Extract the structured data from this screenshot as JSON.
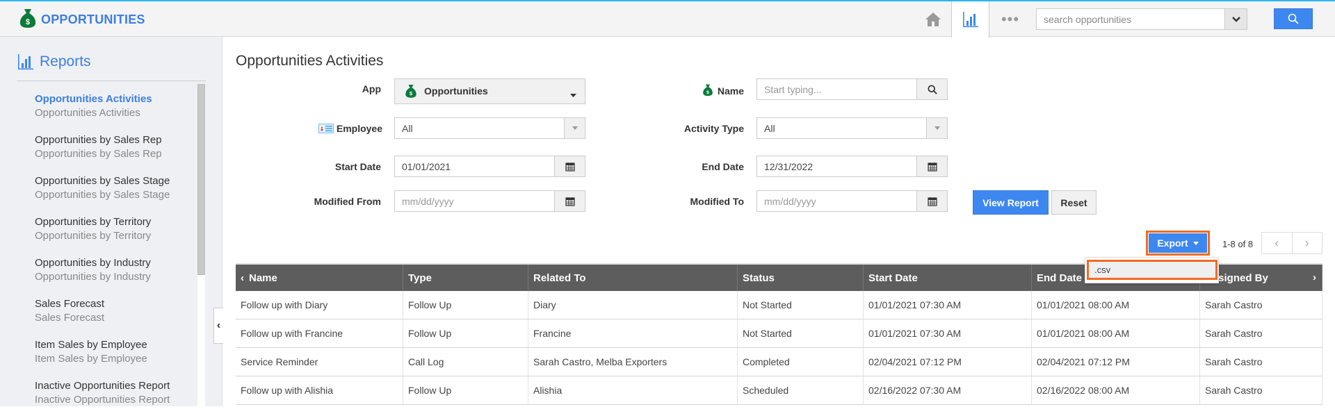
{
  "header": {
    "app_title": "OPPORTUNITIES",
    "icons": [
      "money-bag-icon",
      "home-icon",
      "bar-chart-icon",
      "more-dots-icon"
    ],
    "search": {
      "placeholder": "search opportunities",
      "value": ""
    },
    "search_button_icon": "search-icon",
    "accent_color": "#3d7fe0"
  },
  "sidebar": {
    "title": "Reports",
    "items": [
      {
        "title": "Opportunities Activities",
        "subtitle": "Opportunities Activities",
        "active": true
      },
      {
        "title": "Opportunities by Sales Rep",
        "subtitle": "Opportunities by Sales Rep"
      },
      {
        "title": "Opportunities by Sales Stage",
        "subtitle": "Opportunities by Sales Stage"
      },
      {
        "title": "Opportunities by Territory",
        "subtitle": "Opportunities by Territory"
      },
      {
        "title": "Opportunities by Industry",
        "subtitle": "Opportunities by Industry"
      },
      {
        "title": "Sales Forecast",
        "subtitle": "Sales Forecast"
      },
      {
        "title": "Item Sales by Employee",
        "subtitle": "Item Sales by Employee"
      },
      {
        "title": "Inactive Opportunities Report",
        "subtitle": "Inactive Opportunities Report"
      }
    ]
  },
  "main": {
    "title": "Opportunities Activities",
    "filters": {
      "app": {
        "label": "App",
        "value": "Opportunities"
      },
      "employee": {
        "label": "Employee",
        "value": "All"
      },
      "start_date": {
        "label": "Start Date",
        "value": "01/01/2021"
      },
      "modified_from": {
        "label": "Modified From",
        "placeholder": "mm/dd/yyyy"
      },
      "name": {
        "label": "Name",
        "placeholder": "Start typing..."
      },
      "activity_type": {
        "label": "Activity Type",
        "value": "All"
      },
      "end_date": {
        "label": "End Date",
        "value": "12/31/2022"
      },
      "modified_to": {
        "label": "Modified To",
        "placeholder": "mm/dd/yyyy"
      }
    },
    "buttons": {
      "view_report": "View Report",
      "reset": "Reset",
      "export": "Export"
    },
    "export_menu": [
      ".csv"
    ],
    "pagination": {
      "text": "1-8 of 8"
    },
    "table": {
      "columns": [
        "Name",
        "Type",
        "Related To",
        "Status",
        "Start Date",
        "End Date",
        "Assigned By"
      ],
      "rows": [
        [
          "Follow up with Diary",
          "Follow Up",
          "Diary",
          "Not Started",
          "01/01/2021 07:30 AM",
          "01/01/2021 08:00 AM",
          "Sarah Castro"
        ],
        [
          "Follow up with Francine",
          "Follow Up",
          "Francine",
          "Not Started",
          "01/01/2021 07:30 AM",
          "01/01/2021 08:00 AM",
          "Sarah Castro"
        ],
        [
          "Service Reminder",
          "Call Log",
          "Sarah Castro, Melba Exporters",
          "Completed",
          "02/04/2021 07:12 PM",
          "02/04/2021 07:12 PM",
          "Sarah Castro"
        ],
        [
          "Follow up with Alishia",
          "Follow Up",
          "Alishia",
          "Scheduled",
          "02/16/2022 07:30 AM",
          "02/16/2022 08:00 AM",
          "Sarah Castro"
        ]
      ]
    }
  }
}
